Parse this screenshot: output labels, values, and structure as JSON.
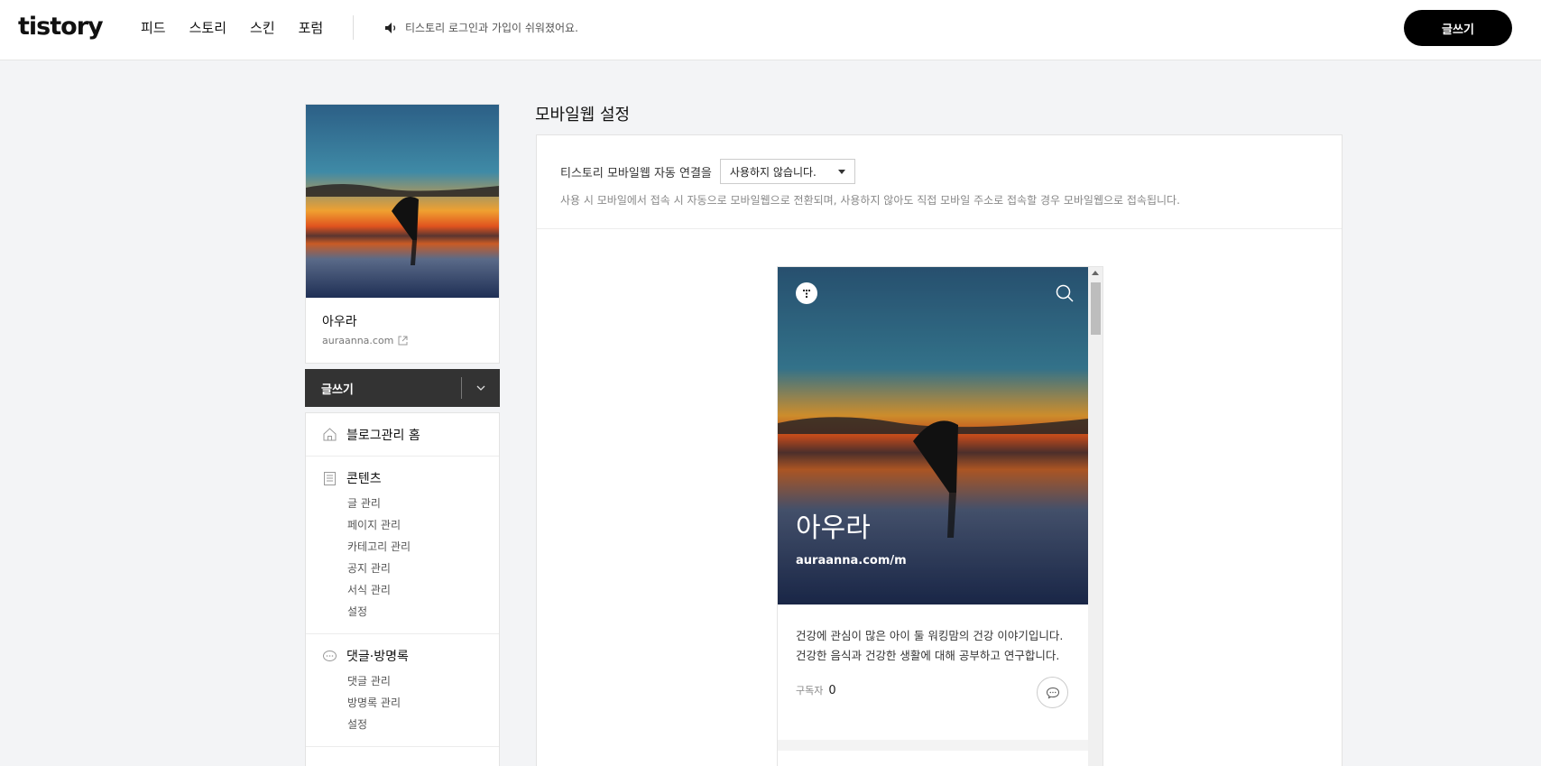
{
  "header": {
    "logo": "tistory",
    "nav": [
      "피드",
      "스토리",
      "스킨",
      "포럼"
    ],
    "notice": "티스토리 로그인과 가입이 쉬워졌어요.",
    "write_button": "글쓰기"
  },
  "profile": {
    "name": "아우라",
    "url": "auraanna.com"
  },
  "sidebar": {
    "write_label": "글쓰기",
    "home": "블로그관리 홈",
    "groups": [
      {
        "title": "콘텐츠",
        "items": [
          "글 관리",
          "페이지 관리",
          "카테고리 관리",
          "공지 관리",
          "서식 관리",
          "설정"
        ]
      },
      {
        "title": "댓글·방명록",
        "items": [
          "댓글 관리",
          "방명록 관리",
          "설정"
        ]
      }
    ]
  },
  "main": {
    "title": "모바일웹 설정",
    "setting_label": "티스토리 모바일웹 자동 연결을",
    "select_value": "사용하지 않습니다.",
    "help": "사용 시 모바일에서 접속 시 자동으로 모바일웹으로 전환되며, 사용하지 않아도 직접 모바일 주소로 접속할 경우 모바일웹으로 접속됩니다."
  },
  "preview": {
    "blog_title": "아우라",
    "blog_url": "auraanna.com/m",
    "desc_line1": "건강에 관심이 많은 아이 둘 워킹맘의 건강 이야기입니다.",
    "desc_line2": "건강한 음식과 건강한 생활에 대해 공부하고 연구합니다.",
    "subscribers_label": "구독자",
    "subscribers_count": "0"
  }
}
